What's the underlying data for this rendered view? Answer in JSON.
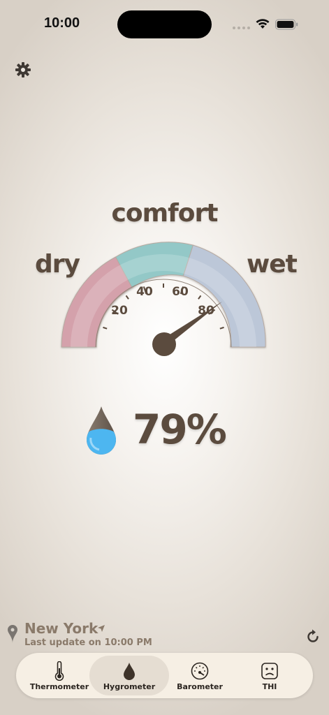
{
  "status_bar": {
    "time": "10:00"
  },
  "gauge": {
    "title": "comfort",
    "left_label": "dry",
    "right_label": "wet",
    "ticks": [
      "20",
      "40",
      "60",
      "80"
    ],
    "needle_value": 80,
    "colors": {
      "dry": "#d4a1ab",
      "comfort": "#93c8c7",
      "wet": "#bcc7d8",
      "needle": "#5b4b3e"
    }
  },
  "reading": {
    "humidity": "79%",
    "drop_icon": "water-drop-icon"
  },
  "location": {
    "city": "New York",
    "last_update": "Last update on 10:00 PM"
  },
  "tabs": [
    {
      "label": "Thermometer",
      "icon": "thermometer-icon",
      "active": false
    },
    {
      "label": "Hygrometer",
      "icon": "water-drop-icon",
      "active": true
    },
    {
      "label": "Barometer",
      "icon": "gauge-icon",
      "active": false
    },
    {
      "label": "THI",
      "icon": "sad-face-icon",
      "active": false
    }
  ]
}
